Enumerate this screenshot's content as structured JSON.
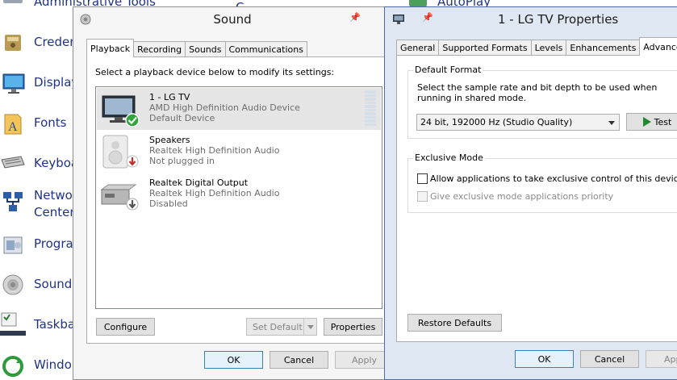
{
  "control_panel": {
    "items": [
      {
        "label": "Administrative Tools",
        "icon": "admin-tools-icon"
      },
      {
        "label": "Creden",
        "icon": "credential-manager-icon"
      },
      {
        "label": "Display",
        "icon": "display-icon"
      },
      {
        "label": "Fonts",
        "icon": "fonts-icon"
      },
      {
        "label": "Keyboa",
        "icon": "keyboard-icon"
      },
      {
        "label": "Netwo",
        "label2": "Center",
        "icon": "network-icon"
      },
      {
        "label": "Progra",
        "icon": "programs-icon"
      },
      {
        "label": "Sound",
        "icon": "sound-icon"
      },
      {
        "label": "Taskba",
        "icon": "taskbar-icon"
      },
      {
        "label": "Windo",
        "icon": "windows-update-icon"
      }
    ],
    "right_items": [
      {
        "label": "AutoPlay"
      }
    ]
  },
  "sound_window": {
    "title": "Sound",
    "tabs": [
      "Playback",
      "Recording",
      "Sounds",
      "Communications"
    ],
    "active_tab": "Playback",
    "instruction": "Select a playback device below to modify its settings:",
    "devices": [
      {
        "name": "1 - LG TV",
        "driver": "AMD High Definition Audio Device",
        "status": "Default Device",
        "icon": "tv-icon",
        "badge": "green-check-icon",
        "selected": true
      },
      {
        "name": "Speakers",
        "driver": "Realtek High Definition Audio",
        "status": "Not plugged in",
        "icon": "speaker-icon",
        "badge": "red-down-arrow-icon",
        "selected": false
      },
      {
        "name": "Realtek Digital Output",
        "driver": "Realtek High Definition Audio",
        "status": "Disabled",
        "icon": "digital-output-icon",
        "badge": "gray-down-arrow-icon",
        "selected": false
      }
    ],
    "buttons": {
      "configure": "Configure",
      "set_default": "Set Default",
      "properties": "Properties",
      "ok": "OK",
      "cancel": "Cancel",
      "apply": "Apply"
    }
  },
  "lg_window": {
    "title": "1 - LG TV Properties",
    "tabs": [
      "General",
      "Supported Formats",
      "Levels",
      "Enhancements",
      "Advanced"
    ],
    "active_tab": "Advanced",
    "default_format": {
      "title": "Default Format",
      "description": "Select the sample rate and bit depth to be used when running in shared mode.",
      "selected_format": "24 bit, 192000 Hz (Studio Quality)",
      "test_label": "Test"
    },
    "exclusive_mode": {
      "title": "Exclusive Mode",
      "allow_label": "Allow applications to take exclusive control of this device",
      "allow_checked": false,
      "priority_label": "Give exclusive mode applications priority",
      "priority_checked": false,
      "priority_enabled": false
    },
    "buttons": {
      "restore": "Restore Defaults",
      "ok": "OK",
      "cancel": "Cancel",
      "apply": "Apply"
    }
  }
}
